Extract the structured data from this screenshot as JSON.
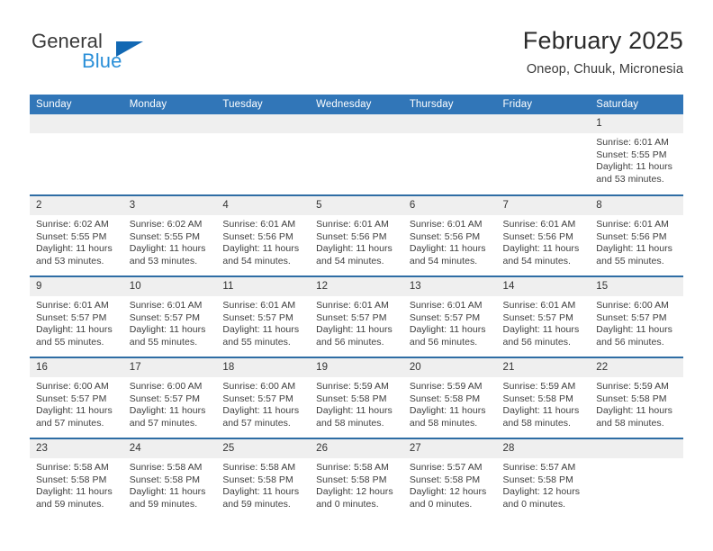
{
  "brand": {
    "name_top": "General",
    "name_bottom": "Blue",
    "triangle_color": "#1268b3",
    "blue_color": "#2a8fd8"
  },
  "header": {
    "title": "February 2025",
    "subtitle": "Oneop, Chuuk, Micronesia"
  },
  "theme": {
    "header_row_bg": "#3176b8",
    "row_divider": "#2e6da4",
    "day_number_bg": "#efefef",
    "text": "#3d3d3d"
  },
  "weekday_headers": [
    "Sunday",
    "Monday",
    "Tuesday",
    "Wednesday",
    "Thursday",
    "Friday",
    "Saturday"
  ],
  "labels": {
    "sunrise": "Sunrise:",
    "sunset": "Sunset:",
    "daylight": "Daylight:"
  },
  "weeks": [
    [
      {
        "day": "",
        "blank": true
      },
      {
        "day": "",
        "blank": true
      },
      {
        "day": "",
        "blank": true
      },
      {
        "day": "",
        "blank": true
      },
      {
        "day": "",
        "blank": true
      },
      {
        "day": "",
        "blank": true
      },
      {
        "day": "1",
        "sunrise": "Sunrise: 6:01 AM",
        "sunset": "Sunset: 5:55 PM",
        "daylight1": "Daylight: 11 hours",
        "daylight2": "and 53 minutes."
      }
    ],
    [
      {
        "day": "2",
        "sunrise": "Sunrise: 6:02 AM",
        "sunset": "Sunset: 5:55 PM",
        "daylight1": "Daylight: 11 hours",
        "daylight2": "and 53 minutes."
      },
      {
        "day": "3",
        "sunrise": "Sunrise: 6:02 AM",
        "sunset": "Sunset: 5:55 PM",
        "daylight1": "Daylight: 11 hours",
        "daylight2": "and 53 minutes."
      },
      {
        "day": "4",
        "sunrise": "Sunrise: 6:01 AM",
        "sunset": "Sunset: 5:56 PM",
        "daylight1": "Daylight: 11 hours",
        "daylight2": "and 54 minutes."
      },
      {
        "day": "5",
        "sunrise": "Sunrise: 6:01 AM",
        "sunset": "Sunset: 5:56 PM",
        "daylight1": "Daylight: 11 hours",
        "daylight2": "and 54 minutes."
      },
      {
        "day": "6",
        "sunrise": "Sunrise: 6:01 AM",
        "sunset": "Sunset: 5:56 PM",
        "daylight1": "Daylight: 11 hours",
        "daylight2": "and 54 minutes."
      },
      {
        "day": "7",
        "sunrise": "Sunrise: 6:01 AM",
        "sunset": "Sunset: 5:56 PM",
        "daylight1": "Daylight: 11 hours",
        "daylight2": "and 54 minutes."
      },
      {
        "day": "8",
        "sunrise": "Sunrise: 6:01 AM",
        "sunset": "Sunset: 5:56 PM",
        "daylight1": "Daylight: 11 hours",
        "daylight2": "and 55 minutes."
      }
    ],
    [
      {
        "day": "9",
        "sunrise": "Sunrise: 6:01 AM",
        "sunset": "Sunset: 5:57 PM",
        "daylight1": "Daylight: 11 hours",
        "daylight2": "and 55 minutes."
      },
      {
        "day": "10",
        "sunrise": "Sunrise: 6:01 AM",
        "sunset": "Sunset: 5:57 PM",
        "daylight1": "Daylight: 11 hours",
        "daylight2": "and 55 minutes."
      },
      {
        "day": "11",
        "sunrise": "Sunrise: 6:01 AM",
        "sunset": "Sunset: 5:57 PM",
        "daylight1": "Daylight: 11 hours",
        "daylight2": "and 55 minutes."
      },
      {
        "day": "12",
        "sunrise": "Sunrise: 6:01 AM",
        "sunset": "Sunset: 5:57 PM",
        "daylight1": "Daylight: 11 hours",
        "daylight2": "and 56 minutes."
      },
      {
        "day": "13",
        "sunrise": "Sunrise: 6:01 AM",
        "sunset": "Sunset: 5:57 PM",
        "daylight1": "Daylight: 11 hours",
        "daylight2": "and 56 minutes."
      },
      {
        "day": "14",
        "sunrise": "Sunrise: 6:01 AM",
        "sunset": "Sunset: 5:57 PM",
        "daylight1": "Daylight: 11 hours",
        "daylight2": "and 56 minutes."
      },
      {
        "day": "15",
        "sunrise": "Sunrise: 6:00 AM",
        "sunset": "Sunset: 5:57 PM",
        "daylight1": "Daylight: 11 hours",
        "daylight2": "and 56 minutes."
      }
    ],
    [
      {
        "day": "16",
        "sunrise": "Sunrise: 6:00 AM",
        "sunset": "Sunset: 5:57 PM",
        "daylight1": "Daylight: 11 hours",
        "daylight2": "and 57 minutes."
      },
      {
        "day": "17",
        "sunrise": "Sunrise: 6:00 AM",
        "sunset": "Sunset: 5:57 PM",
        "daylight1": "Daylight: 11 hours",
        "daylight2": "and 57 minutes."
      },
      {
        "day": "18",
        "sunrise": "Sunrise: 6:00 AM",
        "sunset": "Sunset: 5:57 PM",
        "daylight1": "Daylight: 11 hours",
        "daylight2": "and 57 minutes."
      },
      {
        "day": "19",
        "sunrise": "Sunrise: 5:59 AM",
        "sunset": "Sunset: 5:58 PM",
        "daylight1": "Daylight: 11 hours",
        "daylight2": "and 58 minutes."
      },
      {
        "day": "20",
        "sunrise": "Sunrise: 5:59 AM",
        "sunset": "Sunset: 5:58 PM",
        "daylight1": "Daylight: 11 hours",
        "daylight2": "and 58 minutes."
      },
      {
        "day": "21",
        "sunrise": "Sunrise: 5:59 AM",
        "sunset": "Sunset: 5:58 PM",
        "daylight1": "Daylight: 11 hours",
        "daylight2": "and 58 minutes."
      },
      {
        "day": "22",
        "sunrise": "Sunrise: 5:59 AM",
        "sunset": "Sunset: 5:58 PM",
        "daylight1": "Daylight: 11 hours",
        "daylight2": "and 58 minutes."
      }
    ],
    [
      {
        "day": "23",
        "sunrise": "Sunrise: 5:58 AM",
        "sunset": "Sunset: 5:58 PM",
        "daylight1": "Daylight: 11 hours",
        "daylight2": "and 59 minutes."
      },
      {
        "day": "24",
        "sunrise": "Sunrise: 5:58 AM",
        "sunset": "Sunset: 5:58 PM",
        "daylight1": "Daylight: 11 hours",
        "daylight2": "and 59 minutes."
      },
      {
        "day": "25",
        "sunrise": "Sunrise: 5:58 AM",
        "sunset": "Sunset: 5:58 PM",
        "daylight1": "Daylight: 11 hours",
        "daylight2": "and 59 minutes."
      },
      {
        "day": "26",
        "sunrise": "Sunrise: 5:58 AM",
        "sunset": "Sunset: 5:58 PM",
        "daylight1": "Daylight: 12 hours",
        "daylight2": "and 0 minutes."
      },
      {
        "day": "27",
        "sunrise": "Sunrise: 5:57 AM",
        "sunset": "Sunset: 5:58 PM",
        "daylight1": "Daylight: 12 hours",
        "daylight2": "and 0 minutes."
      },
      {
        "day": "28",
        "sunrise": "Sunrise: 5:57 AM",
        "sunset": "Sunset: 5:58 PM",
        "daylight1": "Daylight: 12 hours",
        "daylight2": "and 0 minutes."
      },
      {
        "day": "",
        "blank": true
      }
    ]
  ]
}
